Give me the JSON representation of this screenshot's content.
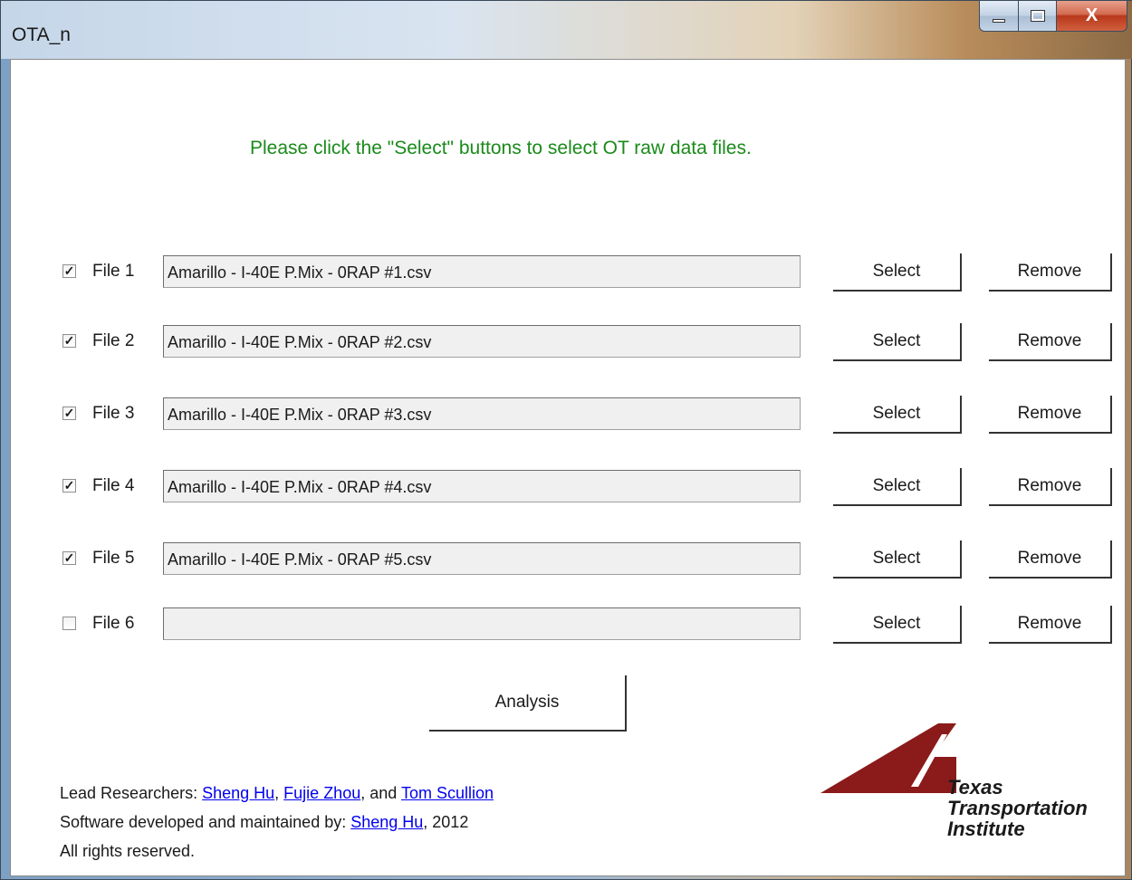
{
  "window": {
    "title": "OTA_n",
    "close_glyph": "X"
  },
  "instruction": "Please click the \"Select\" buttons to select OT raw data files.",
  "files": [
    {
      "checked": true,
      "label": "File 1",
      "path": "Amarillo - I-40E P.Mix - 0RAP #1.csv",
      "select_label": "Select",
      "remove_label": "Remove"
    },
    {
      "checked": true,
      "label": "File 2",
      "path": "Amarillo - I-40E P.Mix - 0RAP #2.csv",
      "select_label": "Select",
      "remove_label": "Remove"
    },
    {
      "checked": true,
      "label": "File 3",
      "path": "Amarillo - I-40E P.Mix - 0RAP #3.csv",
      "select_label": "Select",
      "remove_label": "Remove"
    },
    {
      "checked": true,
      "label": "File 4",
      "path": "Amarillo - I-40E P.Mix - 0RAP #4.csv",
      "select_label": "Select",
      "remove_label": "Remove"
    },
    {
      "checked": true,
      "label": "File 5",
      "path": "Amarillo - I-40E P.Mix - 0RAP #5.csv",
      "select_label": "Select",
      "remove_label": "Remove"
    },
    {
      "checked": false,
      "label": "File 6",
      "path": "",
      "select_label": "Select",
      "remove_label": "Remove"
    }
  ],
  "analysis_label": "Analysis",
  "footer": {
    "lead_prefix": "Lead Researchers: ",
    "researcher1": "Sheng Hu",
    "sep1": ",  ",
    "researcher2": "Fujie Zhou",
    "sep2": ",  and ",
    "researcher3": "Tom Scullion",
    "dev_prefix": "Software developed and maintained by: ",
    "developer": "Sheng Hu",
    "dev_suffix": ", 2012",
    "rights": "All rights reserved."
  },
  "logo": {
    "line1": "Texas",
    "line2": "Transportation",
    "line3": "Institute",
    "color": "#8b1a1a"
  },
  "colors": {
    "instruction": "#1a8a1a",
    "link": "#0000ee"
  }
}
